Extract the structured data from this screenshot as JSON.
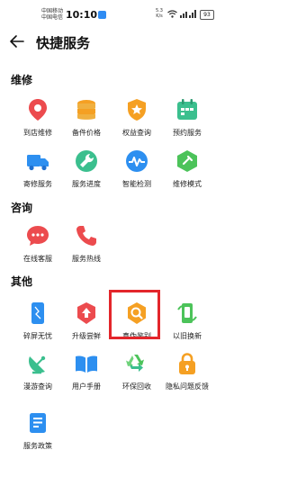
{
  "status_bar": {
    "carrier1": "中国移动",
    "carrier2": "中国电信",
    "time": "10:10",
    "speed_value": "5.3",
    "speed_unit": "K/s",
    "battery": "93"
  },
  "header": {
    "title": "快捷服务"
  },
  "sections": [
    {
      "title": "维修",
      "items": [
        {
          "label": "到店维修",
          "icon": "location-pin-icon"
        },
        {
          "label": "备件价格",
          "icon": "coin-stack-icon"
        },
        {
          "label": "权益查询",
          "icon": "shield-star-icon"
        },
        {
          "label": "预约服务",
          "icon": "calendar-icon"
        },
        {
          "label": "寄修服务",
          "icon": "truck-icon"
        },
        {
          "label": "服务进度",
          "icon": "wrench-icon"
        },
        {
          "label": "智能检测",
          "icon": "pulse-icon"
        },
        {
          "label": "维修模式",
          "icon": "hexagon-tool-icon"
        }
      ]
    },
    {
      "title": "咨询",
      "items": [
        {
          "label": "在线客服",
          "icon": "chat-bubble-icon"
        },
        {
          "label": "服务热线",
          "icon": "phone-icon"
        }
      ]
    },
    {
      "title": "其他",
      "items": [
        {
          "label": "碎屏无忧",
          "icon": "cracked-phone-icon"
        },
        {
          "label": "升级尝鲜",
          "icon": "upgrade-arrow-icon"
        },
        {
          "label": "真伪鉴别",
          "icon": "authenticity-search-icon"
        },
        {
          "label": "以旧换新",
          "icon": "trade-in-phone-icon"
        },
        {
          "label": "漫游查询",
          "icon": "satellite-dish-icon"
        },
        {
          "label": "用户手册",
          "icon": "open-book-icon"
        },
        {
          "label": "环保回收",
          "icon": "recycle-icon"
        },
        {
          "label": "隐私问题反馈",
          "icon": "lock-icon"
        },
        {
          "label": "服务政策",
          "icon": "policy-document-icon"
        }
      ]
    }
  ],
  "colors": {
    "red": "#ec4b4e",
    "orange": "#f5a023",
    "blue": "#2d8ff0",
    "teal": "#3bbf8e",
    "green": "#4cc35a",
    "highlight_border": "#e3262b"
  }
}
